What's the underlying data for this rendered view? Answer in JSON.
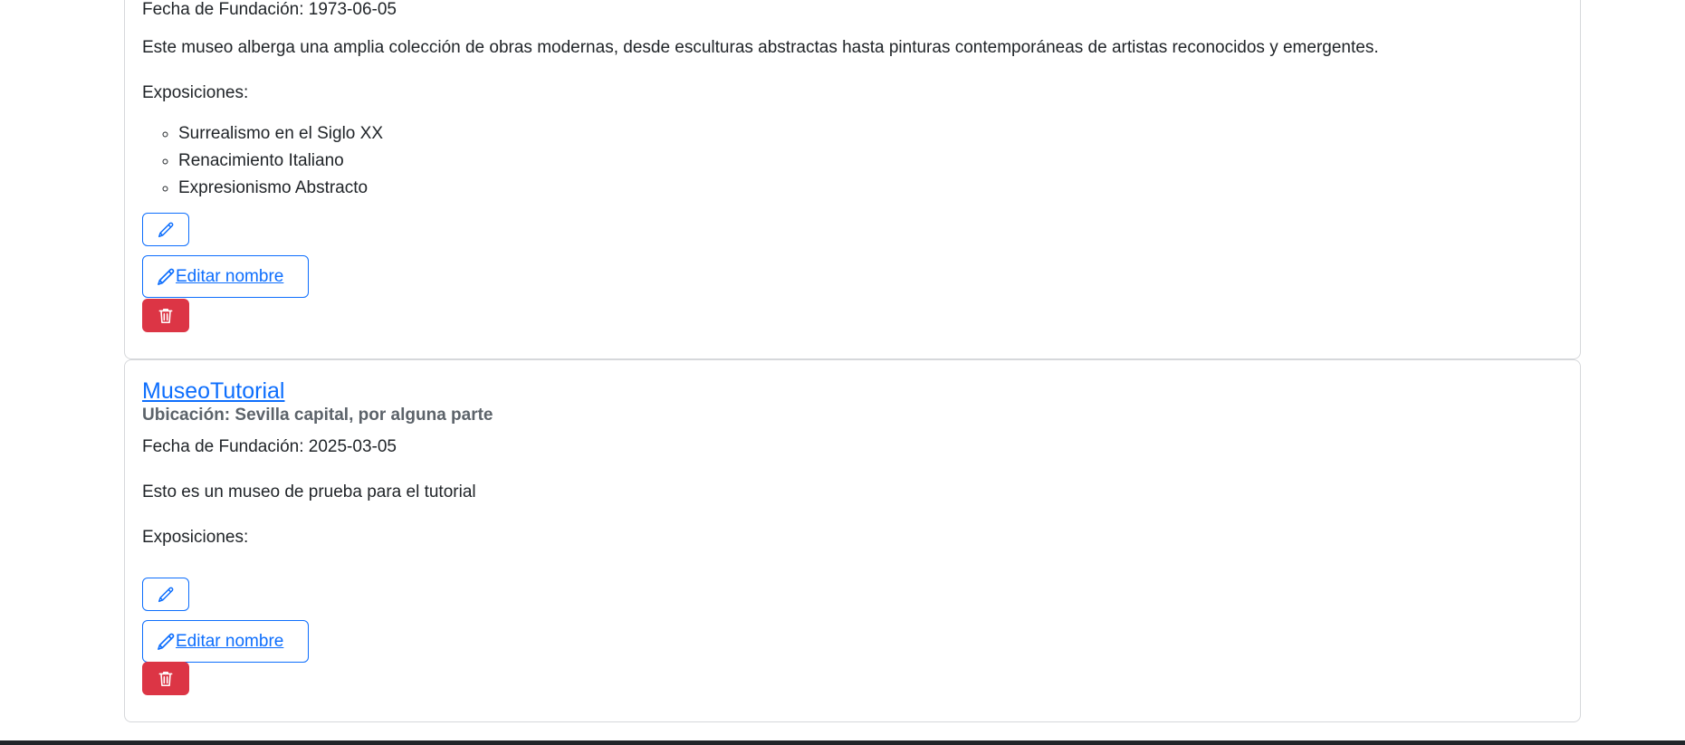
{
  "museums": [
    {
      "name": "",
      "location": "",
      "founded": "Fecha de Fundación: 1973-06-05",
      "description": "Este museo alberga una amplia colección de obras modernas, desde esculturas abstractas hasta pinturas contemporáneas de artistas reconocidos y emergentes.",
      "exhibitions_label": "Exposiciones:",
      "exhibitions": [
        "Surrealismo en el Siglo XX",
        "Renacimiento Italiano",
        "Expresionismo Abstracto"
      ],
      "edit_name_label": " Editar nombre"
    },
    {
      "name": "MuseoTutorial",
      "location": "Ubicación: Sevilla capital, por alguna parte",
      "founded": "Fecha de Fundación: 2025-03-05",
      "description": "Esto es un museo de prueba para el tutorial",
      "exhibitions_label": "Exposiciones:",
      "exhibitions": [],
      "edit_name_label": " Editar nombre"
    }
  ],
  "icons": {
    "edit": "pencil-icon",
    "delete": "trash-icon"
  },
  "colors": {
    "primary": "#0d6efd",
    "danger": "#dc3545",
    "border": "#d6d8db",
    "footer": "#212529"
  }
}
